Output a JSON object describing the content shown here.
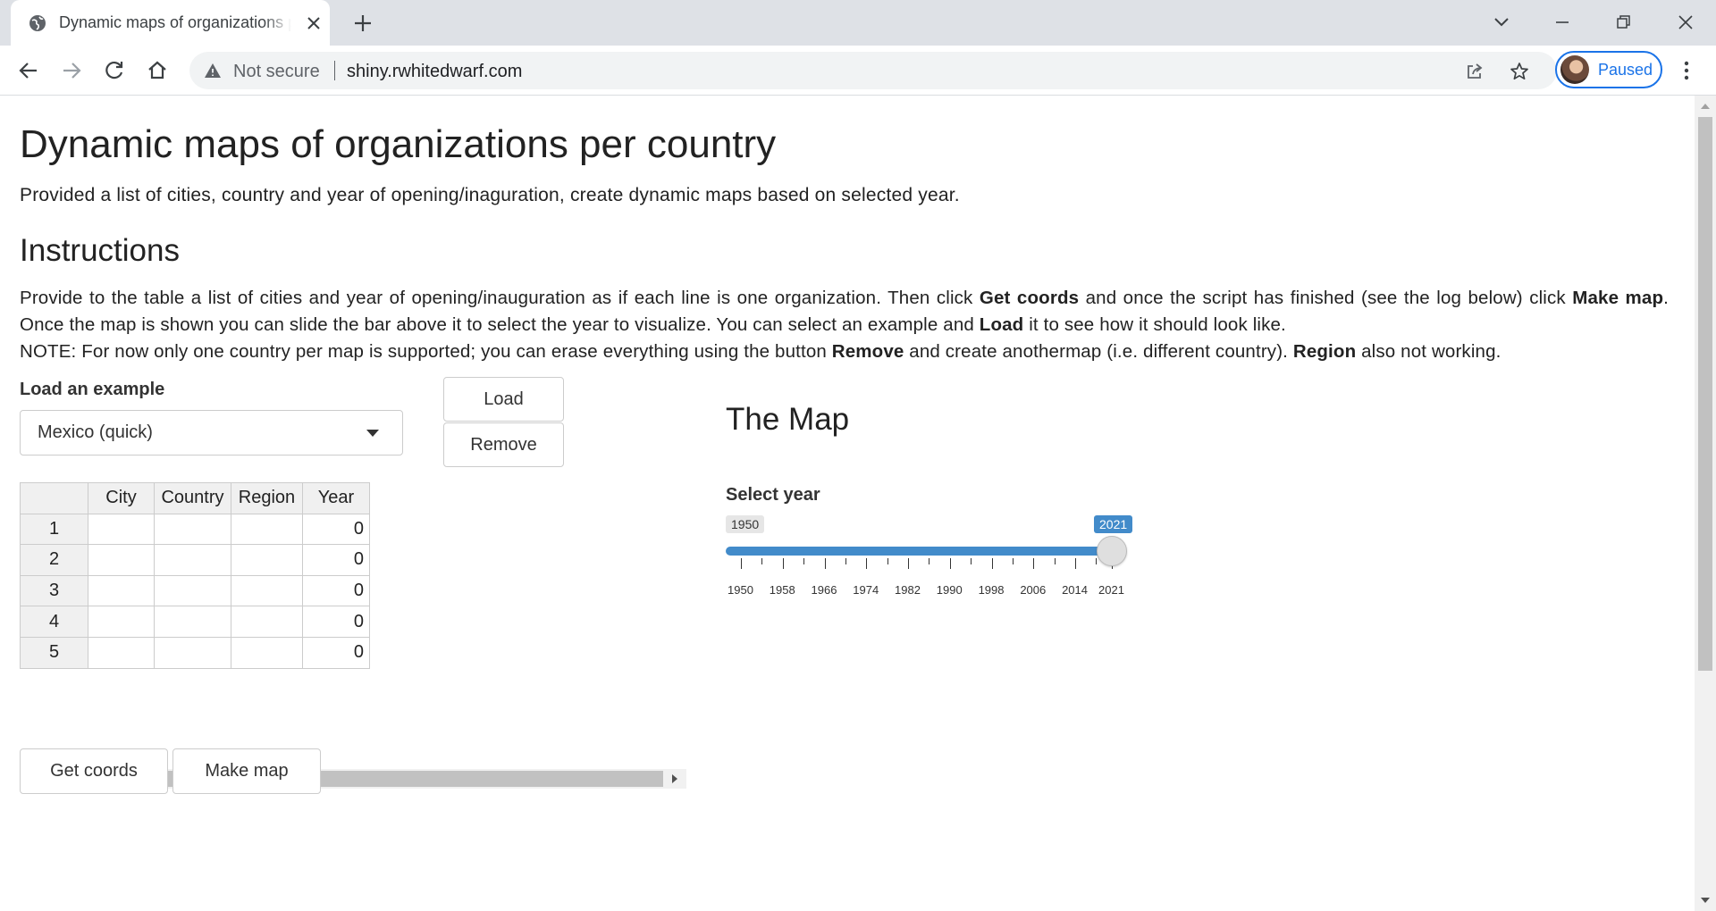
{
  "browser": {
    "tab_title": "Dynamic maps of organizations per country",
    "url_security": "Not secure",
    "url": "shiny.rwhitedwarf.com",
    "profile_label": "Paused"
  },
  "page": {
    "title": "Dynamic maps of organizations per country",
    "subtitle": "Provided a list of cities, country and year of opening/inaguration, create dynamic maps based on selected year.",
    "instructions_heading": "Instructions",
    "instr": {
      "p1": "Provide to the table a list of cities and year of opening/inauguration as if each line is one organization. Then click ",
      "b1": "Get coords",
      "p2": " and once the script has finished (see the log below) click ",
      "b2": "Make map",
      "p3": ". Once the map is shown you can slide the bar above it to select the year to visualize. You can select an example and ",
      "b3": "Load",
      "p4": " it to see how it should look like.",
      "p5": "NOTE: For now only one country per map is supported; you can erase everything using the button ",
      "b4": "Remove",
      "p6": " and create anothermap (i.e. different country). ",
      "b5": "Region",
      "p7": " also not working."
    }
  },
  "controls": {
    "example_label": "Load an example",
    "example_selected": "Mexico (quick)",
    "load_button": "Load",
    "remove_button": "Remove",
    "get_coords_button": "Get coords",
    "make_map_button": "Make map"
  },
  "table": {
    "columns": [
      "City",
      "Country",
      "Region",
      "Year"
    ],
    "rows": [
      {
        "n": "1",
        "city": "",
        "country": "",
        "region": "",
        "year": "0"
      },
      {
        "n": "2",
        "city": "",
        "country": "",
        "region": "",
        "year": "0"
      },
      {
        "n": "3",
        "city": "",
        "country": "",
        "region": "",
        "year": "0"
      },
      {
        "n": "4",
        "city": "",
        "country": "",
        "region": "",
        "year": "0"
      },
      {
        "n": "5",
        "city": "",
        "country": "",
        "region": "",
        "year": "0"
      }
    ]
  },
  "map": {
    "title": "The Map",
    "slider_label": "Select year",
    "min": 1950,
    "max": 2021,
    "value": 2021,
    "min_label": "1950",
    "value_label": "2021",
    "tick_labels": [
      "1950",
      "1958",
      "1966",
      "1974",
      "1982",
      "1990",
      "1998",
      "2006",
      "2014",
      "2021"
    ]
  },
  "colors": {
    "accent": "#428bca",
    "chrome_bg": "#dee1e6",
    "profile_blue": "#1a73e8"
  },
  "icons": {
    "tab_favicon": "globe-icon",
    "security": "warning-triangle-icon"
  }
}
